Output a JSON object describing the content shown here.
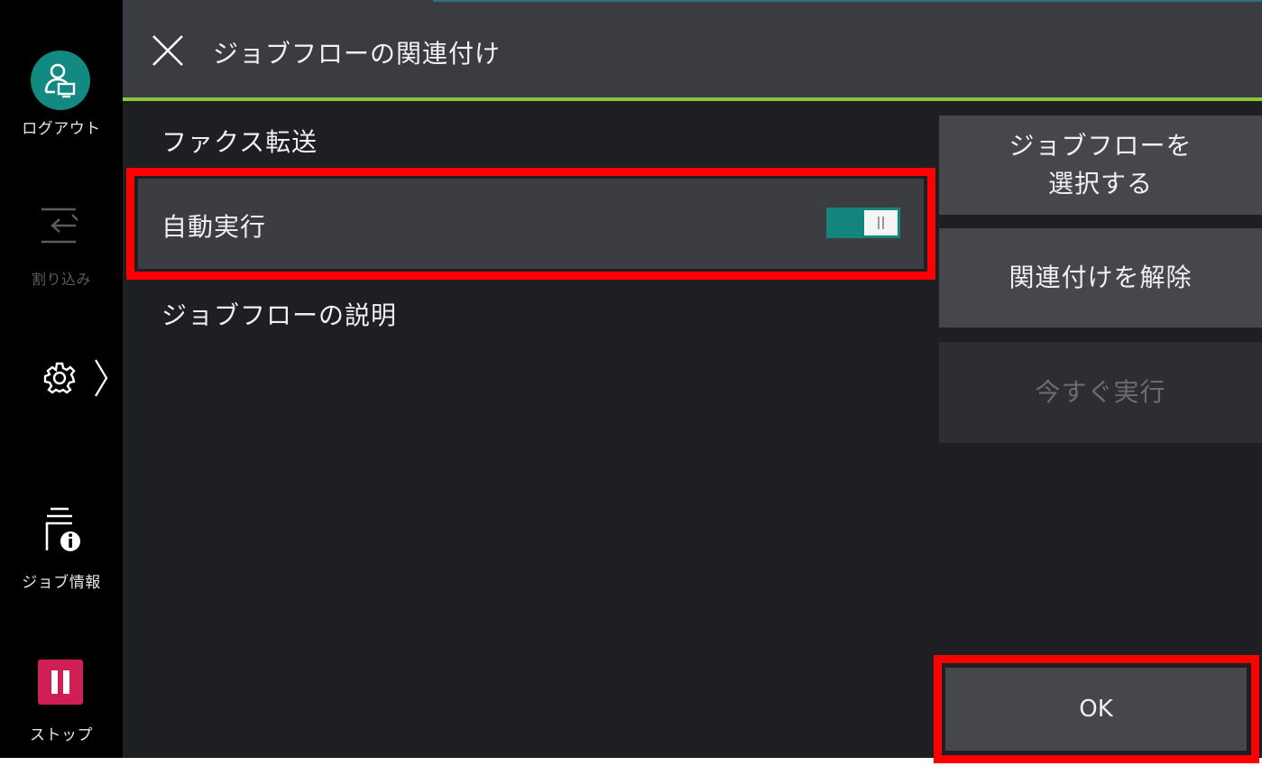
{
  "header": {
    "title": "ジョブフローの関連付け"
  },
  "rail": {
    "logout_label": "ログアウト",
    "interrupt_label": "割り込み",
    "job_info_label": "ジョブ情報",
    "stop_label": "ストップ"
  },
  "list": {
    "fax_forward": "ファクス転送",
    "auto_run": "自動実行",
    "auto_run_state": "on",
    "job_flow_description": "ジョブフローの説明"
  },
  "actions": {
    "select_job_flow": "ジョブフローを\n選択する",
    "unlink": "関連付けを解除",
    "run_now": "今すぐ実行",
    "ok": "OK"
  },
  "colors": {
    "accent_teal": "#128a82",
    "header_accent_green": "#8cc63f",
    "stop_red": "#cf1f55",
    "highlight_red": "#ff0000"
  },
  "icons": [
    "close-icon",
    "logout-user-icon",
    "interrupt-icon",
    "gear-icon",
    "chevron-right-icon",
    "job-info-icon",
    "stop-icon"
  ]
}
